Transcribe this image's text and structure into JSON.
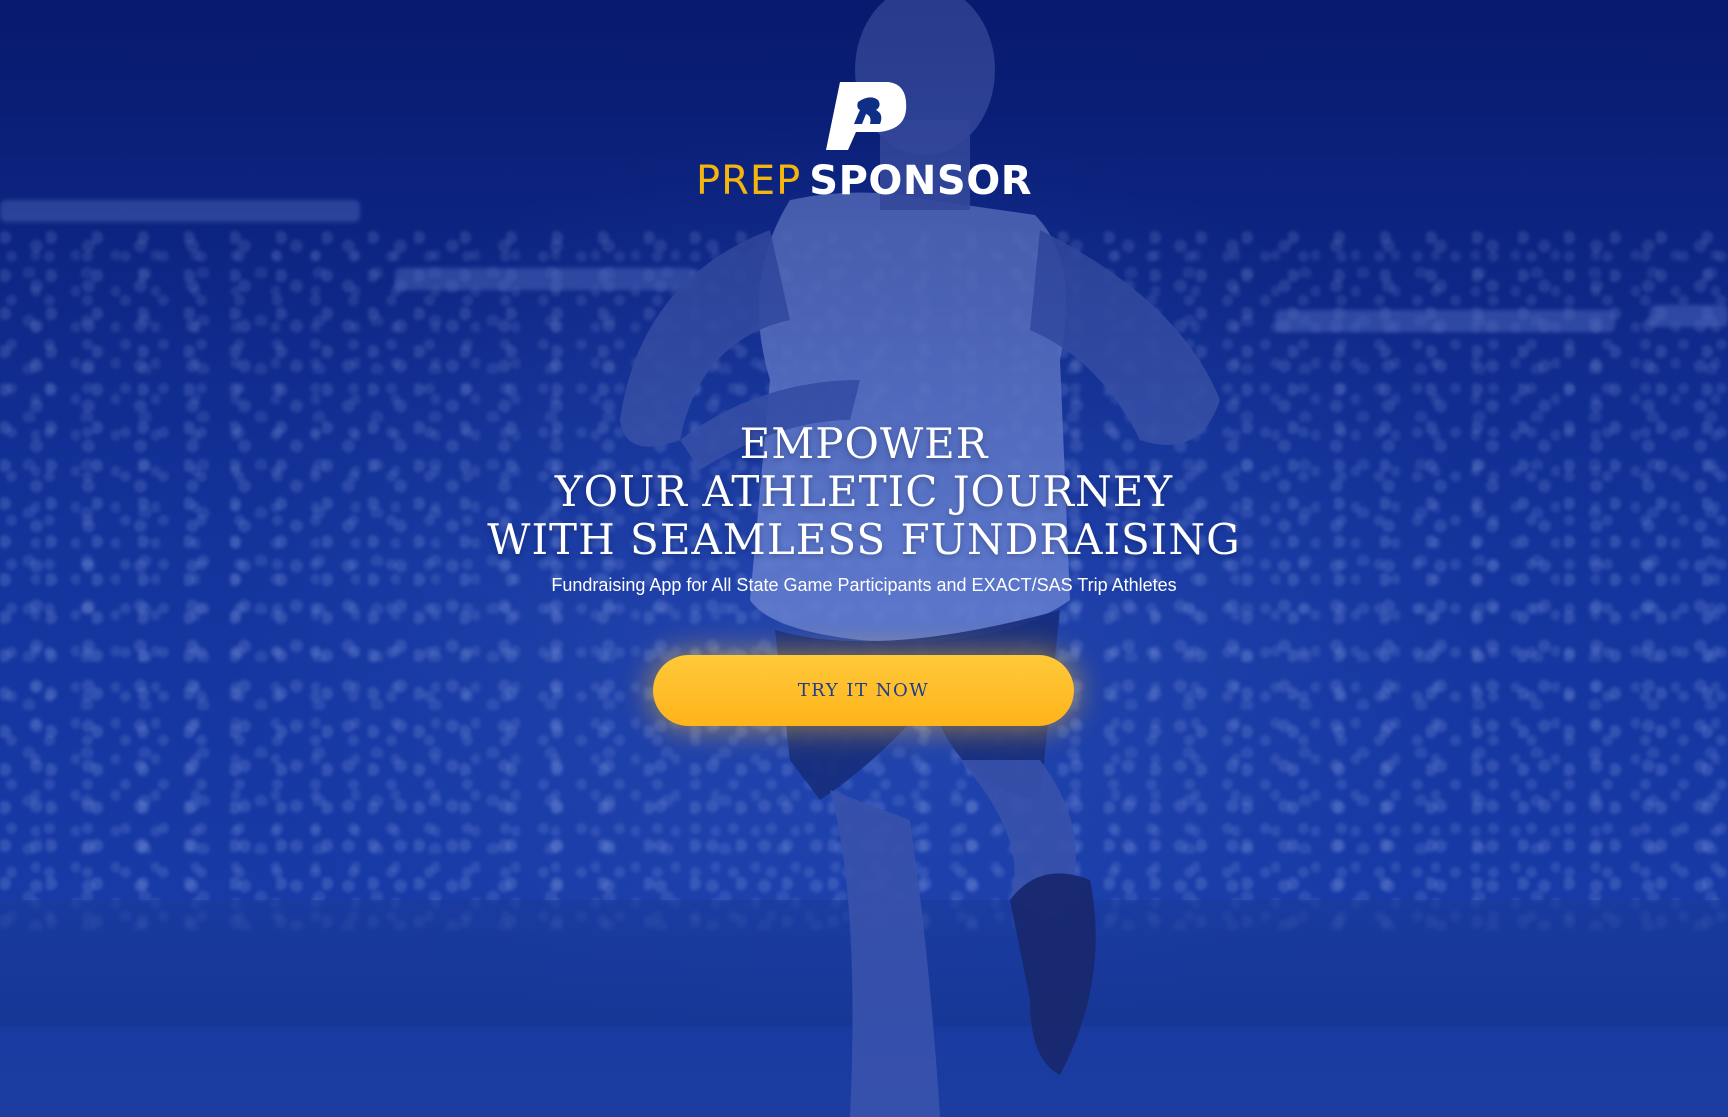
{
  "brand": {
    "logo_prep": "PREP",
    "logo_sponsor": "SPONSOR",
    "logo_icon": "runner-p-logo-icon",
    "colors": {
      "gold": "#f5b50f",
      "white": "#ffffff",
      "navy_overlay": "#0b1e6e"
    }
  },
  "hero": {
    "headline_lines": [
      "EMPOWER",
      "YOUR ATHLETIC JOURNEY",
      "WITH SEAMLESS FUNDRAISING"
    ],
    "subheadline": "Fundraising App for All State Game Participants and EXACT/SAS Trip Athletes",
    "cta_label": "TRY IT NOW",
    "cta_color": "#ffb41b",
    "cta_text_color": "#1b3d8f"
  }
}
